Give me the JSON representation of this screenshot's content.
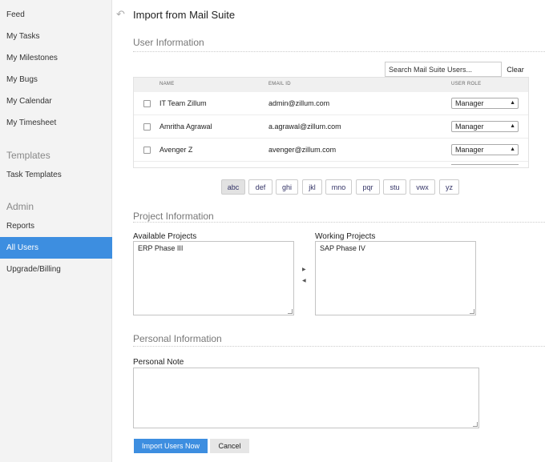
{
  "sidebar": {
    "items_top": [
      {
        "label": "Feed"
      },
      {
        "label": "My Tasks"
      },
      {
        "label": "My Milestones"
      },
      {
        "label": "My Bugs"
      },
      {
        "label": "My Calendar"
      },
      {
        "label": "My Timesheet"
      }
    ],
    "templates_header": "Templates",
    "templates_items": [
      {
        "label": "Task Templates"
      }
    ],
    "admin_header": "Admin",
    "admin_items": [
      {
        "label": "Reports"
      },
      {
        "label": "All Users",
        "active": true
      },
      {
        "label": "Upgrade/Billing"
      }
    ]
  },
  "page": {
    "back_icon": "back-arrow-icon",
    "title": "Import from Mail Suite"
  },
  "user_info": {
    "section_title": "User Information",
    "search_placeholder": "Search Mail Suite Users...",
    "clear_label": "Clear",
    "columns": {
      "name": "NAME",
      "email": "EMAIL ID",
      "role": "USER ROLE"
    },
    "rows": [
      {
        "name": "IT Team Zillum",
        "email": "admin@zillum.com",
        "role": "Manager"
      },
      {
        "name": "Amritha Agrawal",
        "email": "a.agrawal@zillum.com",
        "role": "Manager"
      },
      {
        "name": "Avenger Z",
        "email": "avenger@zillum.com",
        "role": "Manager"
      }
    ],
    "alphabet": [
      "abc",
      "def",
      "ghi",
      "jkl",
      "mno",
      "pqr",
      "stu",
      "vwx",
      "yz"
    ],
    "selected_alpha": "abc"
  },
  "project_info": {
    "section_title": "Project Information",
    "available_label": "Available Projects",
    "available_projects": [
      "ERP Phase III"
    ],
    "working_label": "Working Projects",
    "working_projects": [
      "SAP Phase IV"
    ]
  },
  "personal_info": {
    "section_title": "Personal Information",
    "note_label": "Personal Note",
    "note_value": ""
  },
  "actions": {
    "import_label": "Import Users Now",
    "cancel_label": "Cancel"
  },
  "colors": {
    "accent": "#3d8ee0",
    "sidebar_bg": "#f3f3f3"
  }
}
